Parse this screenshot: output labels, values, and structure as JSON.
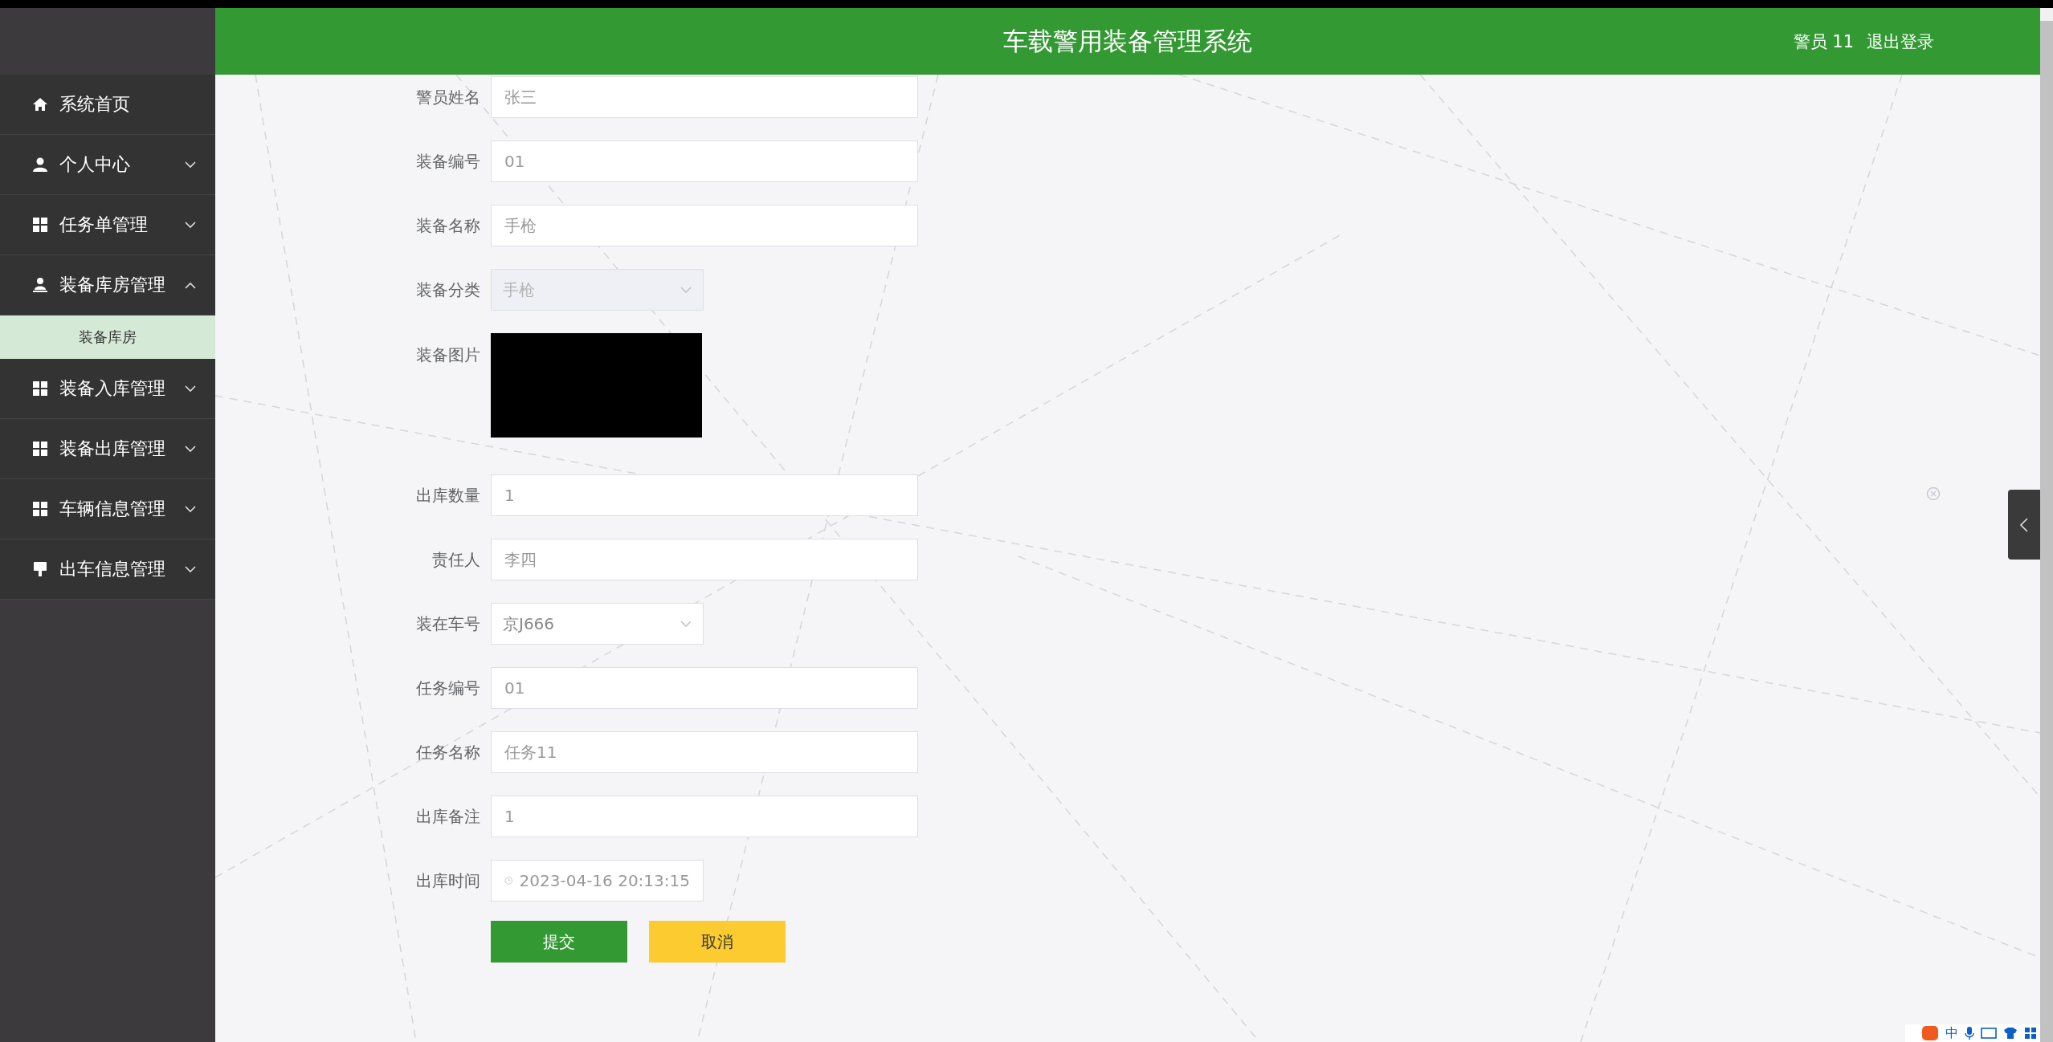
{
  "header": {
    "title": "车载警用装备管理系统",
    "user": "警员 11",
    "logout": "退出登录"
  },
  "sidebar": {
    "items": [
      {
        "label": "系统首页",
        "kind": "link"
      },
      {
        "label": "个人中心",
        "kind": "group",
        "expanded": false
      },
      {
        "label": "任务单管理",
        "kind": "group",
        "expanded": false
      },
      {
        "label": "装备库房管理",
        "kind": "group",
        "expanded": true,
        "children": [
          {
            "label": "装备库房",
            "selected": true
          }
        ]
      },
      {
        "label": "装备入库管理",
        "kind": "group",
        "expanded": false
      },
      {
        "label": "装备出库管理",
        "kind": "group",
        "expanded": false
      },
      {
        "label": "车辆信息管理",
        "kind": "group",
        "expanded": false
      },
      {
        "label": "出车信息管理",
        "kind": "group",
        "expanded": false
      }
    ]
  },
  "form": {
    "fields": [
      {
        "kind": "input",
        "label": "警员姓名",
        "value": "张三"
      },
      {
        "kind": "input",
        "label": "装备编号",
        "value": "01"
      },
      {
        "kind": "input",
        "label": "装备名称",
        "value": "手枪"
      },
      {
        "kind": "select",
        "label": "装备分类",
        "value": "手枪",
        "disabled": true
      },
      {
        "kind": "image",
        "label": "装备图片"
      },
      {
        "kind": "input",
        "label": "出库数量",
        "value": "1"
      },
      {
        "kind": "input",
        "label": "责任人",
        "value": "李四"
      },
      {
        "kind": "select",
        "label": "装在车号",
        "value": "京J666",
        "disabled": false
      },
      {
        "kind": "input",
        "label": "任务编号",
        "value": "01"
      },
      {
        "kind": "input",
        "label": "任务名称",
        "value": "任务11"
      },
      {
        "kind": "input",
        "label": "出库备注",
        "value": "1"
      },
      {
        "kind": "datetime",
        "label": "出库时间",
        "value": "2023-04-16 20:13:15"
      }
    ],
    "buttons": [
      {
        "label": "提交",
        "kind": "primary"
      },
      {
        "label": "取消",
        "kind": "warning"
      }
    ]
  },
  "ime": {
    "label": "中"
  }
}
